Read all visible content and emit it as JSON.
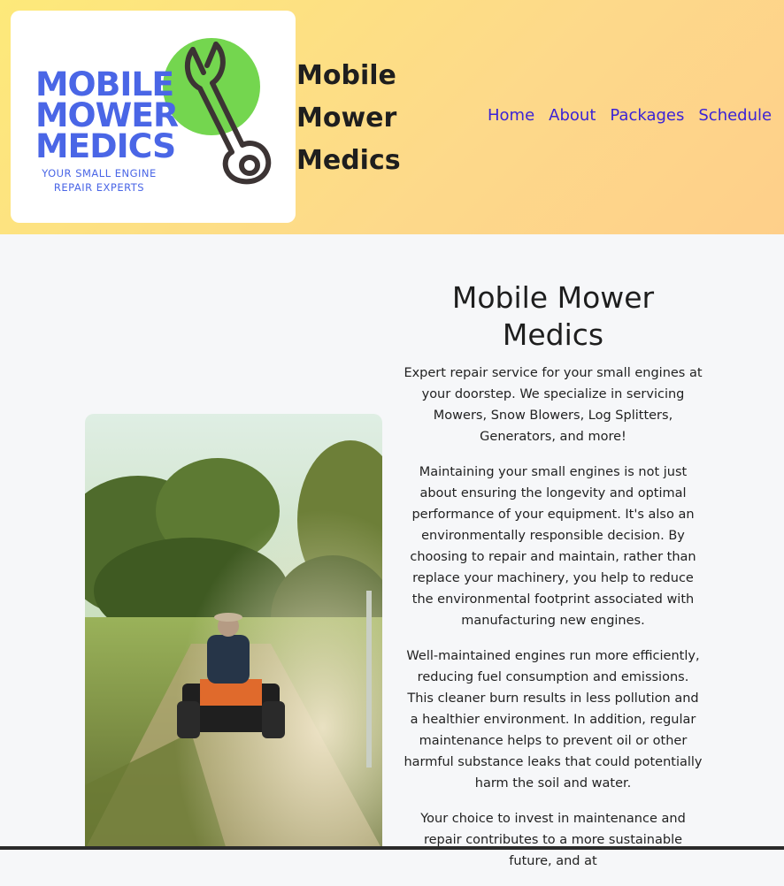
{
  "logo": {
    "line1": "MOBILE",
    "line2": "MOWER",
    "line3": "MEDICS",
    "tagline1": "YOUR SMALL ENGINE",
    "tagline2": "REPAIR EXPERTS",
    "icon": "wrench-icon",
    "colors": {
      "text": "#4a66e6",
      "circle": "#74d64f",
      "wrench": "#3c3434"
    }
  },
  "site_title": {
    "line1": "Mobile",
    "line2": "Mower",
    "line3": "Medics"
  },
  "nav": {
    "home": "Home",
    "about": "About",
    "packages": "Packages",
    "schedule": "Schedule"
  },
  "hero_image": {
    "subject": "person riding a lawn mower down a grassy track"
  },
  "main": {
    "heading": "Mobile Mower Medics",
    "paragraphs": [
      "Expert repair service for your small engines at your doorstep. We specialize in servicing Mowers, Snow Blowers, Log Splitters, Generators, and more!",
      "Maintaining your small engines is not just about ensuring the longevity and optimal performance of your equipment. It's also an environmentally responsible decision. By choosing to repair and maintain, rather than replace your machinery, you help to reduce the environmental footprint associated with manufacturing new engines.",
      "Well-maintained engines run more efficiently, reducing fuel consumption and emissions. This cleaner burn results in less pollution and a healthier environment. In addition, regular maintenance helps to prevent oil or other harmful substance leaks that could potentially harm the soil and water.",
      "Your choice to invest in maintenance and repair contributes to a more sustainable future, and at"
    ]
  },
  "colors": {
    "nav_link": "#3b23d6",
    "header_gradient_start": "#fde97a",
    "header_gradient_end": "#fecf8a"
  }
}
